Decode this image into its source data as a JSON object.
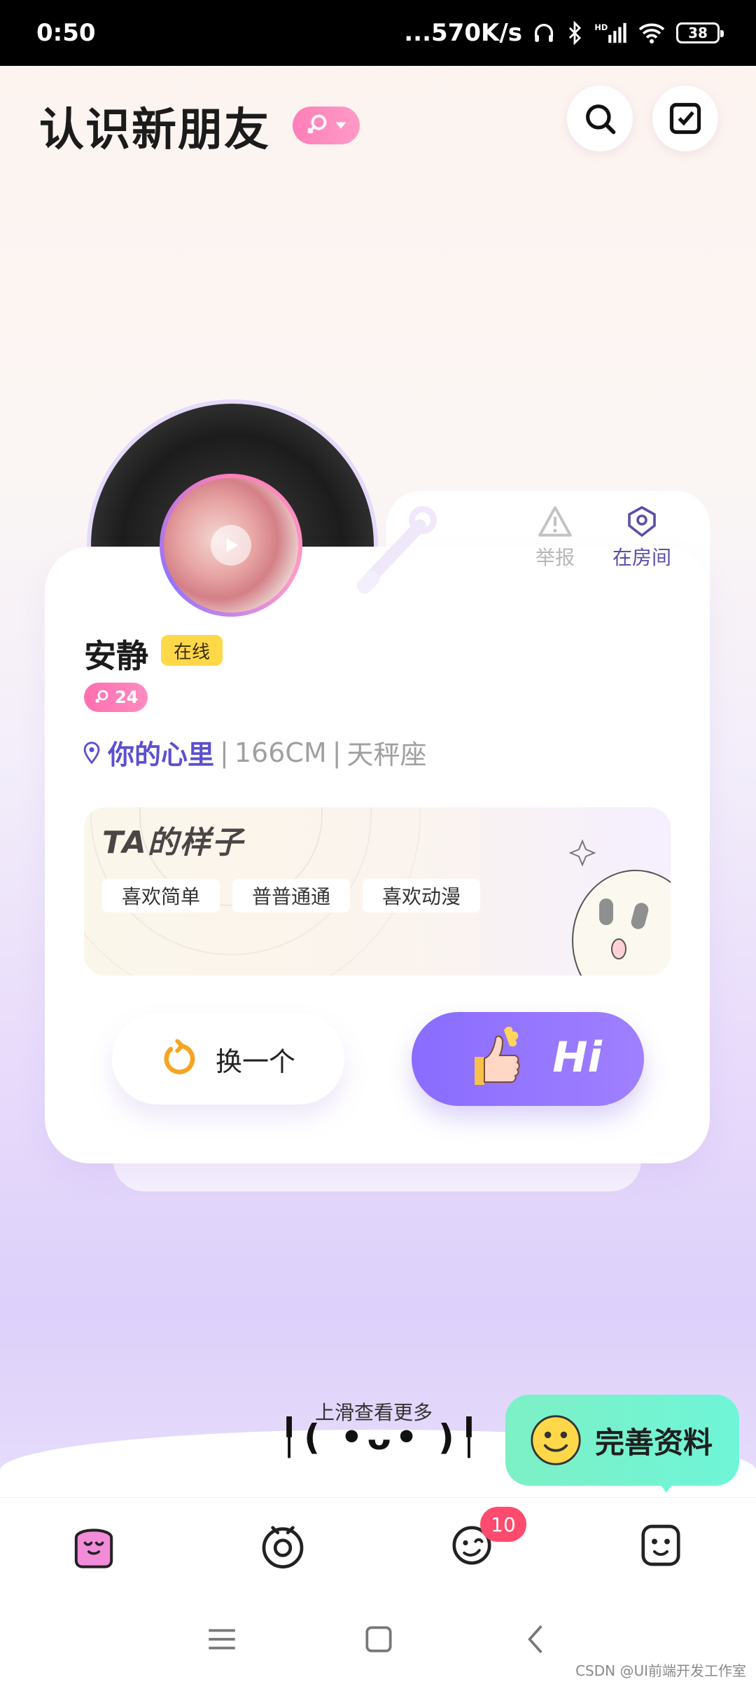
{
  "status_bar": {
    "time": "0:50",
    "net_speed": "...570K/s",
    "battery": "38"
  },
  "header": {
    "title": "认识新朋友",
    "gender_filter_icon": "female-icon"
  },
  "profile": {
    "name": "安静",
    "status": "在线",
    "age": "24",
    "location": "你的心里",
    "height": "166CM",
    "zodiac": "天秤座",
    "actions": {
      "report": "举报",
      "in_room": "在房间"
    },
    "ta_section": {
      "title": "TA的样子",
      "tags": [
        "喜欢简单",
        "普普通通",
        "喜欢动漫"
      ]
    },
    "buttons": {
      "swap": "换一个",
      "hi": "Hi"
    }
  },
  "footer": {
    "swipe_hint": "上滑查看更多",
    "face": "╿( •ᴗ• )╿",
    "complete_profile": "完善资料"
  },
  "tabbar": {
    "badge_count": "10"
  },
  "watermark": "CSDN @UI前端开发工作室",
  "colors": {
    "accent_purple": "#8a6cff",
    "pink": "#ff7fb8",
    "online_yellow": "#ffd84a",
    "mint": "#7df0c5",
    "badge_red": "#ff4b6e"
  }
}
